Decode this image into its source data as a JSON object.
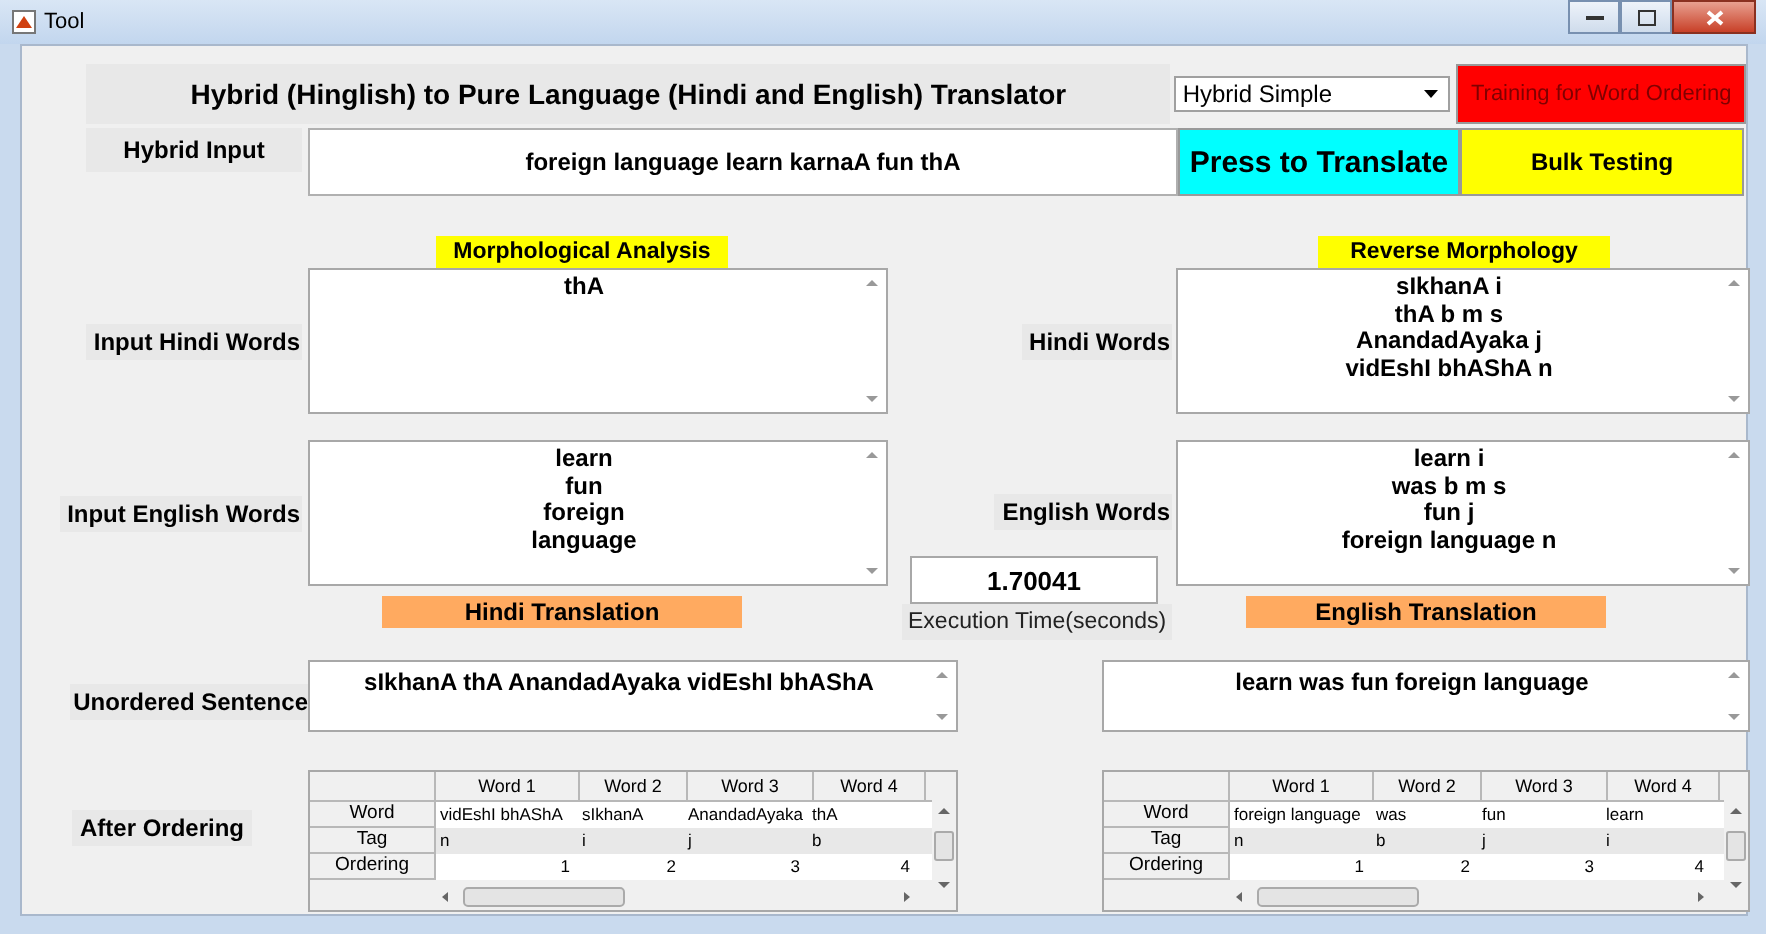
{
  "window": {
    "title": "Tool"
  },
  "header": {
    "title": "Hybrid (Hinglish) to Pure Language (Hindi and English) Translator",
    "mode": "Hybrid Simple",
    "training_button": "Training for Word Ordering"
  },
  "hybrid_input": {
    "label": "Hybrid Input",
    "value": "foreign language learn karnaA fun thA"
  },
  "translate_button": "Press to Translate",
  "bulk_button": "Bulk Testing",
  "panels": [
    {
      "heading": "Morphological Analysis",
      "footer": "Hindi Translation",
      "sections": [
        {
          "label": "Input Hindi Words",
          "lines": [
            "thA"
          ]
        },
        {
          "label": "Input English Words",
          "lines": [
            "learn",
            "fun",
            "foreign",
            "language"
          ]
        }
      ]
    },
    {
      "heading": "Reverse Morphology",
      "footer": "English Translation",
      "sections": [
        {
          "label": "Hindi Words",
          "lines": [
            "sIkhanA i",
            "thA b m s",
            "AnandadAyaka j",
            "vidEshI bhAShA n"
          ]
        },
        {
          "label": "English Words",
          "lines": [
            "learn i",
            "was b m s",
            "fun j",
            "foreign language n"
          ]
        }
      ]
    }
  ],
  "execution": {
    "value": "1.70041",
    "label": "Execution Time(seconds)"
  },
  "unordered": {
    "label": "Unordered Sentence",
    "sentences": [
      "sIkhanA thA AnandadAyaka vidEshI bhAShA",
      "learn was fun foreign language"
    ]
  },
  "ordering": {
    "label": "After Ordering",
    "tables": [
      {
        "columns": [
          "Word 1",
          "Word 2",
          "Word 3",
          "Word 4"
        ],
        "rows": [
          {
            "header": "Word",
            "cells": [
              "vidEshI bhAShA",
              "sIkhanA",
              "AnandadAyaka",
              "thA"
            ]
          },
          {
            "header": "Tag",
            "cells": [
              "n",
              "i",
              "j",
              "b"
            ]
          },
          {
            "header": "Ordering",
            "cells": [
              "1",
              "2",
              "3",
              "4"
            ]
          }
        ]
      },
      {
        "columns": [
          "Word 1",
          "Word 2",
          "Word 3",
          "Word 4"
        ],
        "rows": [
          {
            "header": "Word",
            "cells": [
              "foreign language",
              "was",
              "fun",
              "learn"
            ]
          },
          {
            "header": "Tag",
            "cells": [
              "n",
              "b",
              "j",
              "i"
            ]
          },
          {
            "header": "Ordering",
            "cells": [
              "1",
              "2",
              "3",
              "4"
            ]
          }
        ]
      }
    ]
  }
}
